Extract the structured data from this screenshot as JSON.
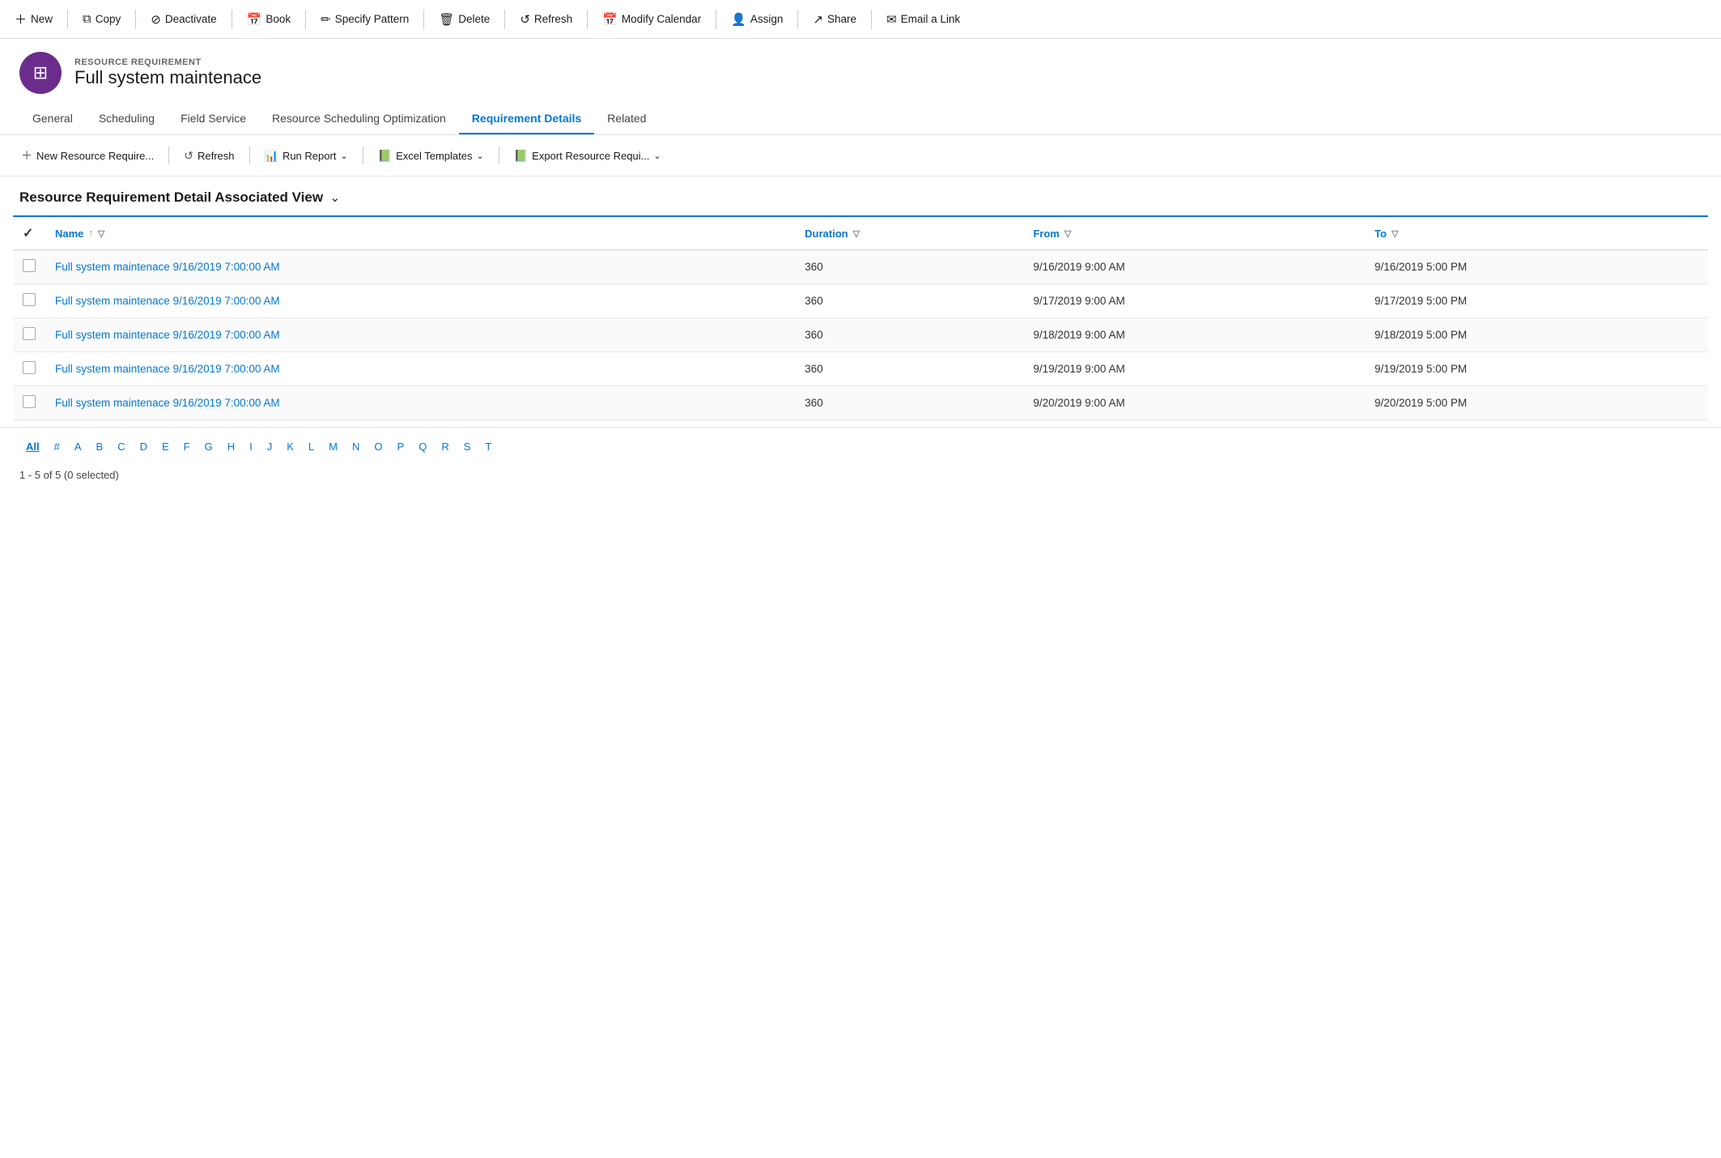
{
  "toolbar": {
    "buttons": [
      {
        "id": "new",
        "label": "New",
        "icon": "＋"
      },
      {
        "id": "copy",
        "label": "Copy",
        "icon": "⧉"
      },
      {
        "id": "deactivate",
        "label": "Deactivate",
        "icon": "⊘"
      },
      {
        "id": "book",
        "label": "Book",
        "icon": "📅"
      },
      {
        "id": "specify-pattern",
        "label": "Specify Pattern",
        "icon": "✏"
      },
      {
        "id": "delete",
        "label": "Delete",
        "icon": "🗑"
      },
      {
        "id": "refresh",
        "label": "Refresh",
        "icon": "↺"
      },
      {
        "id": "modify-calendar",
        "label": "Modify Calendar",
        "icon": "📅"
      },
      {
        "id": "assign",
        "label": "Assign",
        "icon": "👤"
      },
      {
        "id": "share",
        "label": "Share",
        "icon": "↗"
      },
      {
        "id": "email-a-link",
        "label": "Email a Link",
        "icon": "✉"
      }
    ]
  },
  "entity": {
    "type": "RESOURCE REQUIREMENT",
    "title": "Full system maintenace",
    "icon": "⊞"
  },
  "tabs": [
    {
      "id": "general",
      "label": "General",
      "active": false
    },
    {
      "id": "scheduling",
      "label": "Scheduling",
      "active": false
    },
    {
      "id": "field-service",
      "label": "Field Service",
      "active": false
    },
    {
      "id": "rso",
      "label": "Resource Scheduling Optimization",
      "active": false
    },
    {
      "id": "requirement-details",
      "label": "Requirement Details",
      "active": true
    },
    {
      "id": "related",
      "label": "Related",
      "active": false
    }
  ],
  "sub_toolbar": {
    "buttons": [
      {
        "id": "new-resource-require",
        "label": "New Resource Require...",
        "icon": "＋"
      },
      {
        "id": "refresh",
        "label": "Refresh",
        "icon": "↺"
      },
      {
        "id": "run-report",
        "label": "Run Report",
        "icon": "📊",
        "dropdown": true
      },
      {
        "id": "excel-templates",
        "label": "Excel Templates",
        "icon": "📗",
        "dropdown": true
      },
      {
        "id": "export-resource",
        "label": "Export Resource Requi...",
        "icon": "📗",
        "dropdown": true
      }
    ]
  },
  "view": {
    "title": "Resource Requirement Detail Associated View"
  },
  "table": {
    "columns": [
      {
        "id": "name",
        "label": "Name",
        "sortable": true,
        "filterable": true
      },
      {
        "id": "duration",
        "label": "Duration",
        "sortable": false,
        "filterable": true
      },
      {
        "id": "from",
        "label": "From",
        "sortable": false,
        "filterable": true
      },
      {
        "id": "to",
        "label": "To",
        "sortable": false,
        "filterable": true
      }
    ],
    "rows": [
      {
        "name": "Full system maintenace 9/16/2019 7:00:00 AM",
        "duration": "360",
        "from": "9/16/2019 9:00 AM",
        "to": "9/16/2019 5:00 PM"
      },
      {
        "name": "Full system maintenace 9/16/2019 7:00:00 AM",
        "duration": "360",
        "from": "9/17/2019 9:00 AM",
        "to": "9/17/2019 5:00 PM"
      },
      {
        "name": "Full system maintenace 9/16/2019 7:00:00 AM",
        "duration": "360",
        "from": "9/18/2019 9:00 AM",
        "to": "9/18/2019 5:00 PM"
      },
      {
        "name": "Full system maintenace 9/16/2019 7:00:00 AM",
        "duration": "360",
        "from": "9/19/2019 9:00 AM",
        "to": "9/19/2019 5:00 PM"
      },
      {
        "name": "Full system maintenace 9/16/2019 7:00:00 AM",
        "duration": "360",
        "from": "9/20/2019 9:00 AM",
        "to": "9/20/2019 5:00 PM"
      }
    ]
  },
  "alpha_nav": {
    "items": [
      "All",
      "#",
      "A",
      "B",
      "C",
      "D",
      "E",
      "F",
      "G",
      "H",
      "I",
      "J",
      "K",
      "L",
      "M",
      "N",
      "O",
      "P",
      "Q",
      "R",
      "S",
      "T"
    ]
  },
  "status": {
    "text": "1 - 5 of 5 (0 selected)"
  }
}
